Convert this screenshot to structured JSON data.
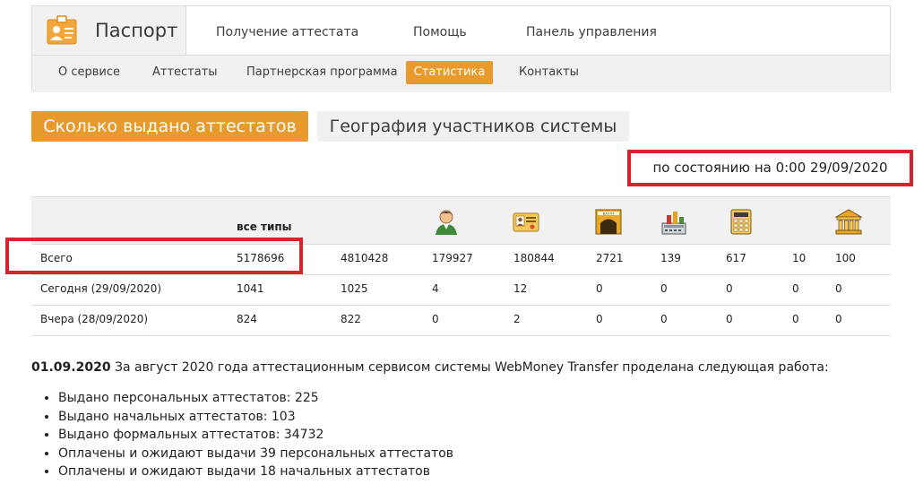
{
  "header": {
    "brand_label": "Паспорт",
    "main_nav": [
      "Получение аттестата",
      "Помощь",
      "Панель управления"
    ],
    "sub_nav": [
      {
        "label": "О сервисе",
        "active": false
      },
      {
        "label": "Аттестаты",
        "active": false
      },
      {
        "label": "Партнерская программа",
        "active": false
      },
      {
        "label": "Статистика",
        "active": true
      },
      {
        "label": "Контакты",
        "active": false
      }
    ]
  },
  "page_tabs": {
    "active_label": "Сколько выдано аттестатов",
    "inactive_label": "География участников системы"
  },
  "status": {
    "text": "по состоянию на 0:00 29/09/2020"
  },
  "table": {
    "all_types_header": "все типы",
    "column_icons": [
      "personal-user-icon",
      "id-card-icon",
      "treasury-vault-icon",
      "seller-register-icon",
      "calculator-icon",
      "bank-building-icon"
    ],
    "rows": [
      {
        "label": "Всего",
        "values": [
          "5178696",
          "4810428",
          "179927",
          "180844",
          "2721",
          "139",
          "617",
          "10",
          "100"
        ]
      },
      {
        "label": "Сегодня (29/09/2020)",
        "values": [
          "1041",
          "1025",
          "4",
          "12",
          "0",
          "0",
          "0",
          "0",
          "0"
        ]
      },
      {
        "label": "Вчера (28/09/2020)",
        "values": [
          "824",
          "822",
          "0",
          "2",
          "0",
          "0",
          "0",
          "0",
          "0"
        ]
      }
    ]
  },
  "news": {
    "date": "01.09.2020",
    "intro": "За август 2020 года аттестационным сервисом системы WebMoney Transfer проделана следующая работа:",
    "items": [
      "Выдано персональных аттестатов: 225",
      "Выдано начальных аттестатов: 103",
      "Выдано формальных аттестатов: 34732",
      "Оплачены и ожидают выдачи 39 персональных аттестатов",
      "Оплачены и ожидают выдачи 18 начальных аттестатов"
    ]
  },
  "colors": {
    "accent": "#e89a2c",
    "highlight": "#d8222c",
    "panel": "#f1f1f1"
  }
}
